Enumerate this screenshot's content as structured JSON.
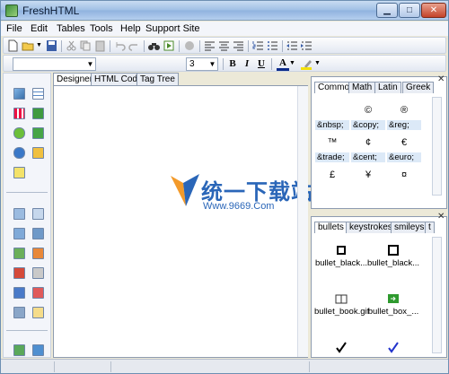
{
  "window": {
    "title": "FreshHTML"
  },
  "menu": [
    "File",
    "Edit",
    "Tables",
    "Tools",
    "Help",
    "Support Site"
  ],
  "toolbar2": {
    "font_size": "3"
  },
  "editor_tabs": [
    "Designer",
    "HTML Code",
    "Tag Tree"
  ],
  "watermark": {
    "text": "统一下载站",
    "url": "Www.9669.Com"
  },
  "entities": {
    "tabs": [
      "Common",
      "Math",
      "Latin",
      "Greek"
    ],
    "rows": [
      [
        {
          "sym": "",
          "code": "&nbsp;"
        },
        {
          "sym": "©",
          "code": "&copy;"
        },
        {
          "sym": "®",
          "code": "&reg;"
        }
      ],
      [
        {
          "sym": "™",
          "code": "&trade;"
        },
        {
          "sym": "¢",
          "code": "&cent;"
        },
        {
          "sym": "€",
          "code": "&euro;"
        }
      ],
      [
        {
          "sym": "£",
          "code": ""
        },
        {
          "sym": "¥",
          "code": ""
        },
        {
          "sym": "¤",
          "code": ""
        }
      ]
    ]
  },
  "images": {
    "tabs": [
      "bullets",
      "keystrokes",
      "smileys",
      "t"
    ],
    "items": [
      "bullet_black...",
      "bullet_black...",
      "bullet_book.gif",
      "bullet_box_..."
    ]
  }
}
